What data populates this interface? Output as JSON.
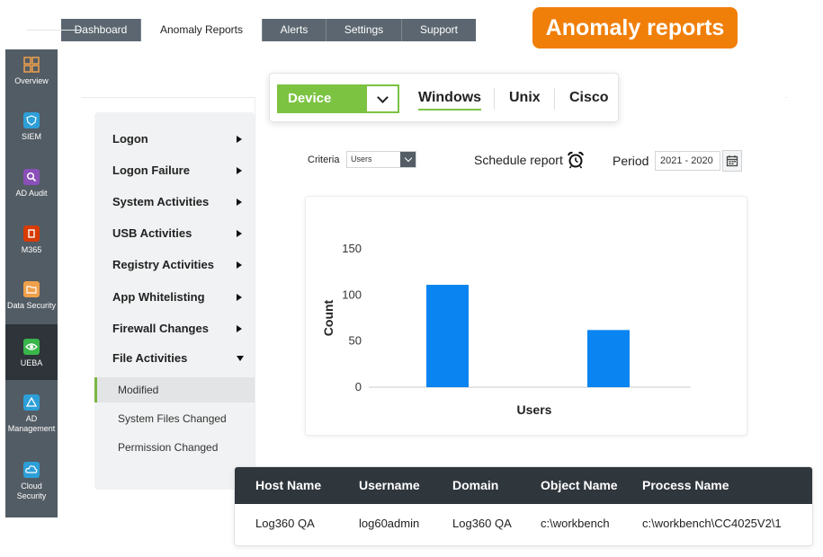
{
  "top_tabs": [
    "Dashboard",
    "Anomaly Reports",
    "Alerts",
    "Settings",
    "Support"
  ],
  "badge": "Anomaly reports",
  "left_nav": [
    {
      "label": "Overview",
      "icon": "grid-icon",
      "color": "#f0a04b"
    },
    {
      "label": "SIEM",
      "icon": "shield-icon",
      "color": "#2d9fd8"
    },
    {
      "label": "AD Audit",
      "icon": "search-icon",
      "color": "#8a4fb8"
    },
    {
      "label": "M365",
      "icon": "office-icon",
      "color": "#d83b01"
    },
    {
      "label": "Data Security",
      "icon": "folder-lock-icon",
      "color": "#f0a04b"
    },
    {
      "label": "UEBA",
      "icon": "eye-icon",
      "color": "#39b54a"
    },
    {
      "label": "AD Management",
      "icon": "pyramid-icon",
      "color": "#2d9fd8"
    },
    {
      "label": "Cloud Security",
      "icon": "cloud-icon",
      "color": "#2d9fd8"
    }
  ],
  "categories": [
    {
      "label": "Logon",
      "expanded": false
    },
    {
      "label": "Logon Failure",
      "expanded": false
    },
    {
      "label": "System Activities",
      "expanded": false
    },
    {
      "label": "USB Activities",
      "expanded": false
    },
    {
      "label": "Registry Activities",
      "expanded": false
    },
    {
      "label": "App Whitelisting",
      "expanded": false
    },
    {
      "label": "Firewall Changes",
      "expanded": false
    },
    {
      "label": "File Activities",
      "expanded": true
    }
  ],
  "sub_items": [
    "Modified",
    "System Files Changed",
    "Permission Changed"
  ],
  "device": {
    "label": "Device"
  },
  "os_tabs": [
    "Windows",
    "Unix",
    "Cisco"
  ],
  "filters": {
    "criteria_label": "Criteria",
    "criteria_value": "Users",
    "schedule_label": "Schedule report",
    "period_label": "Period",
    "period_value": "2021 - 2020"
  },
  "chart_data": {
    "type": "bar",
    "categories": [
      "",
      ""
    ],
    "values": [
      111,
      62
    ],
    "title": "",
    "xlabel": "Users",
    "ylabel": "Count",
    "ylim": [
      0,
      150
    ],
    "yticks": [
      0,
      50,
      100,
      150
    ],
    "bar_color": "#0a84f0",
    "grid": false
  },
  "table": {
    "columns": [
      "Host Name",
      "Username",
      "Domain",
      "Object Name",
      "Process Name"
    ],
    "rows": [
      [
        "Log360 QA",
        "log60admin",
        "Log360 QA",
        "c:\\workbench",
        "c:\\workbench\\CC4025V2\\1"
      ]
    ]
  },
  "colors": {
    "accent_green": "#7cc342",
    "badge_orange": "#f07f0a",
    "sidebar": "#525c64",
    "table_header": "#2f363c"
  }
}
